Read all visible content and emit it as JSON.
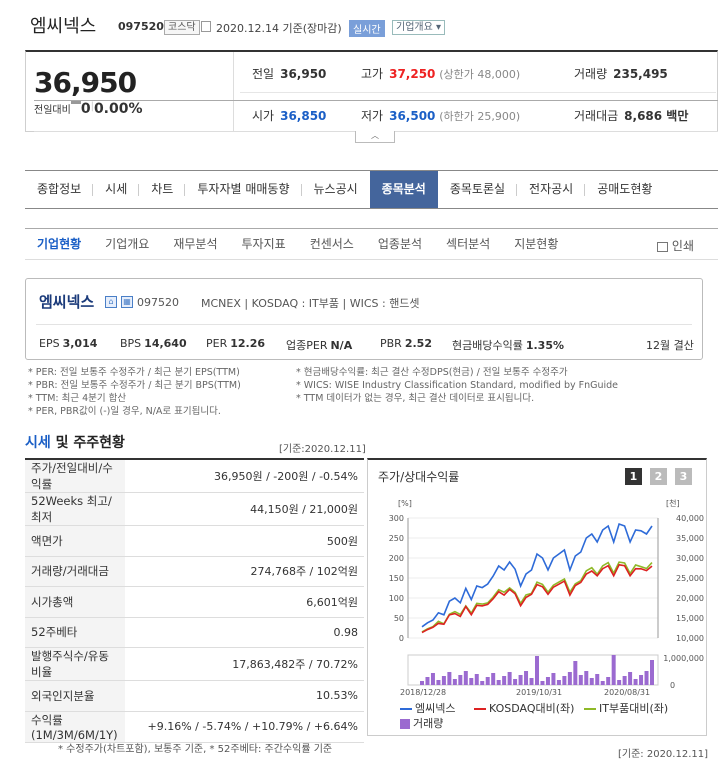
{
  "header": {
    "name": "엠씨넥스",
    "code": "097520",
    "market": "코스닥",
    "date": "2020.12.14 기준(장마감)",
    "realtime": "실시간",
    "info": "기업개요 ▾"
  },
  "price": {
    "current": "36,950",
    "change_label": "전일대비",
    "change_val": "0",
    "change_pct": "0.00%",
    "prev_label": "전일",
    "prev": "36,950",
    "high_label": "고가",
    "high": "37,250",
    "high_limit": "(상한가 48,000)",
    "volume_label": "거래량",
    "volume": "235,495",
    "open_label": "시가",
    "open": "36,850",
    "low_label": "저가",
    "low": "36,500",
    "low_limit": "(하한가 25,900)",
    "amount_label": "거래대금",
    "amount": "8,686 백만"
  },
  "nav": [
    "종합정보",
    "시세",
    "차트",
    "투자자별 매매동향",
    "뉴스공시",
    "종목분석",
    "종목토론실",
    "전자공시",
    "공매도현황"
  ],
  "subnav": [
    "기업현황",
    "기업개요",
    "재무분석",
    "투자지표",
    "컨센서스",
    "업종분석",
    "섹터분석",
    "지분현황"
  ],
  "print_label": "인쇄",
  "company": {
    "name": "엠씨넥스",
    "code": "097520",
    "meta": "MCNEX  |  KOSDAQ : IT부품  |  WICS : 핸드셋",
    "eps_l": "EPS",
    "eps": "3,014",
    "bps_l": "BPS",
    "bps": "14,640",
    "per_l": "PER",
    "per": "12.26",
    "iper_l": "업종PER",
    "iper": "N/A",
    "pbr_l": "PBR",
    "pbr": "2.52",
    "div_l": "현금배당수익률",
    "div": "1.35%",
    "settle": "12월 결산"
  },
  "notes_left": [
    "* PER: 전일 보통주 수정주가 / 최근 분기 EPS(TTM)",
    "* PBR: 전일 보통주 수정주가 / 최근 분기 BPS(TTM)",
    "* TTM: 최근 4분기 합산",
    "* PER, PBR값이 (-)일 경우, N/A로 표기됩니다."
  ],
  "notes_right": [
    "* 현금배당수익률: 최근 결산 수정DPS(현금) / 전일 보통주 수정주가",
    "* WICS: WISE Industry Classification Standard, modified by FnGuide",
    "* TTM 데이터가 없는 경우, 최근 결산 데이터로 표시됩니다."
  ],
  "section": {
    "title_a": "시세",
    "title_b": " 및 주주현황",
    "stamp": "[기준:2020.12.11]"
  },
  "table": [
    {
      "k": "주가/전일대비/수익률",
      "v": "36,950원 / -200원 / -0.54%"
    },
    {
      "k": "52Weeks 최고/최저",
      "v": "44,150원 / 21,000원"
    },
    {
      "k": "액면가",
      "v": "500원"
    },
    {
      "k": "거래량/거래대금",
      "v": "274,768주 / 102억원"
    },
    {
      "k": "시가총액",
      "v": "6,601억원"
    },
    {
      "k": "52주베타",
      "v": "0.98"
    },
    {
      "k": "발행주식수/유동비율",
      "v": "17,863,482주 / 70.72%"
    },
    {
      "k": "외국인지분율",
      "v": "10.53%"
    },
    {
      "k": "수익률 (1M/3M/6M/1Y)",
      "v": "+9.16% / -5.74% / +10.79% / +6.64%"
    }
  ],
  "table_note": "* 수정주가(차트포함), 보통주 기준, * 52주베타: 주간수익률 기준",
  "chart_stamp": "[기준: 2020.12.11]",
  "chart_data": {
    "type": "line",
    "title": "주가/상대수익률",
    "pages": [
      "1",
      "2",
      "3"
    ],
    "left_unit": "[%]",
    "right_unit": "[천]",
    "yticks_left": [
      "300",
      "250",
      "200",
      "150",
      "100",
      "50",
      "0"
    ],
    "yticks_right": [
      "40,000",
      "35,000",
      "30,000",
      "25,000",
      "20,000",
      "15,000",
      "10,000"
    ],
    "vol_tick": "1,000,000",
    "vol_tick0": "0",
    "xticks": [
      "2018/12/28",
      "2019/10/31",
      "2020/08/31"
    ],
    "series": [
      {
        "name": "엠씨넥스",
        "color": "#2e6bd8",
        "values": [
          28,
          38,
          45,
          63,
          58,
          92,
          100,
          88,
          124,
          96,
          130,
          126,
          135,
          155,
          180,
          170,
          190,
          172,
          130,
          160,
          170,
          210,
          200,
          170,
          200,
          210,
          220,
          170,
          205,
          215,
          250,
          260,
          240,
          270,
          280,
          240,
          285,
          280,
          240,
          270,
          268,
          260,
          280
        ]
      },
      {
        "name": "KOSDAQ대비(좌)",
        "color": "#d22",
        "values": [
          null,
          null,
          null,
          null,
          null,
          null,
          null,
          null,
          null,
          null,
          null,
          null,
          null,
          null,
          null,
          null,
          null,
          null,
          null,
          null,
          null,
          null,
          null,
          null,
          null,
          null,
          null,
          null,
          null,
          null,
          null,
          null,
          null,
          null,
          null,
          null,
          null,
          null,
          null,
          null,
          null,
          null,
          null
        ]
      },
      {
        "name": "IT부품대비(좌)",
        "color": "#8fb928",
        "values": []
      }
    ],
    "volume_name": "거래량",
    "volume_color": "#9b6ad0"
  }
}
